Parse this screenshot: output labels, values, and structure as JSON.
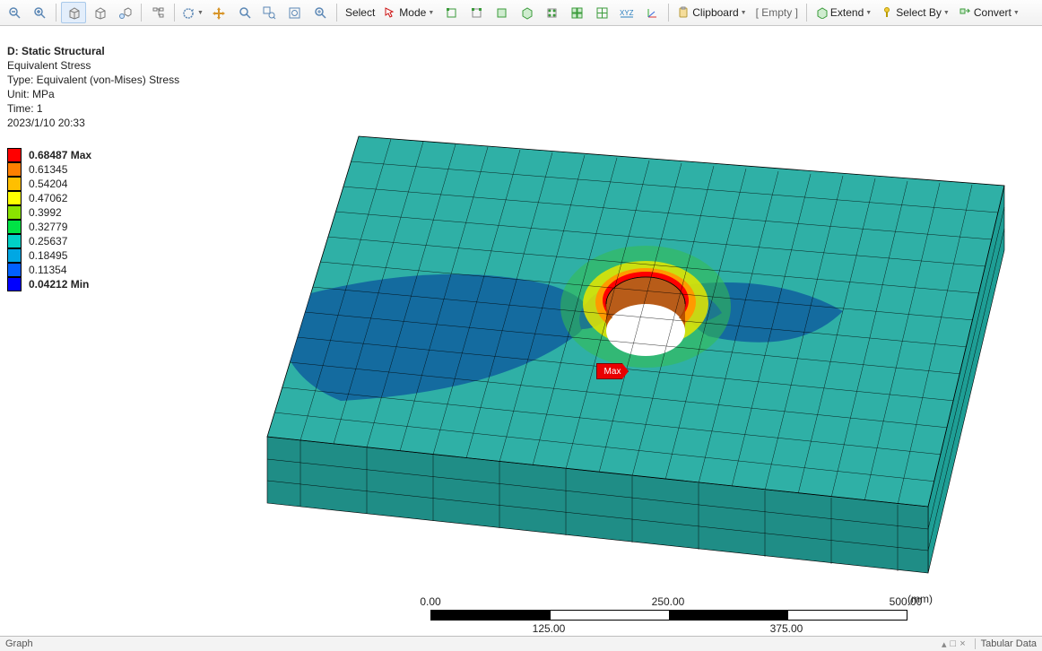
{
  "toolbar": {
    "select": "Select",
    "mode": "Mode",
    "clipboard": "Clipboard",
    "empty": "[ Empty ]",
    "extend": "Extend",
    "selectby": "Select By",
    "convert": "Convert"
  },
  "legend": {
    "header": "D: Static Structural",
    "line1": "Equivalent Stress",
    "line2": "Type: Equivalent (von-Mises) Stress",
    "line3": "Unit: MPa",
    "line4": "Time: 1",
    "line5": "2023/1/10 20:33"
  },
  "contour": {
    "entries": [
      {
        "label": "0.68487 Max",
        "color": "#ff0000",
        "bold": true
      },
      {
        "label": "0.61345",
        "color": "#ff7f00"
      },
      {
        "label": "0.54204",
        "color": "#ffbf00"
      },
      {
        "label": "0.47062",
        "color": "#ffff00"
      },
      {
        "label": "0.3992",
        "color": "#8ae300"
      },
      {
        "label": "0.32779",
        "color": "#00e345"
      },
      {
        "label": "0.25637",
        "color": "#00d0c7"
      },
      {
        "label": "0.18495",
        "color": "#00a7e3"
      },
      {
        "label": "0.11354",
        "color": "#0060ff"
      },
      {
        "label": "0.04212 Min",
        "color": "#0000ff",
        "bold": true
      }
    ]
  },
  "scale": {
    "major": [
      "0.00",
      "250.00",
      "500.00"
    ],
    "minor": [
      "125.00",
      "375.00"
    ],
    "unit": "(mm)"
  },
  "maxflag": "Max",
  "footer": {
    "left": "Graph",
    "right": "Tabular Data"
  }
}
